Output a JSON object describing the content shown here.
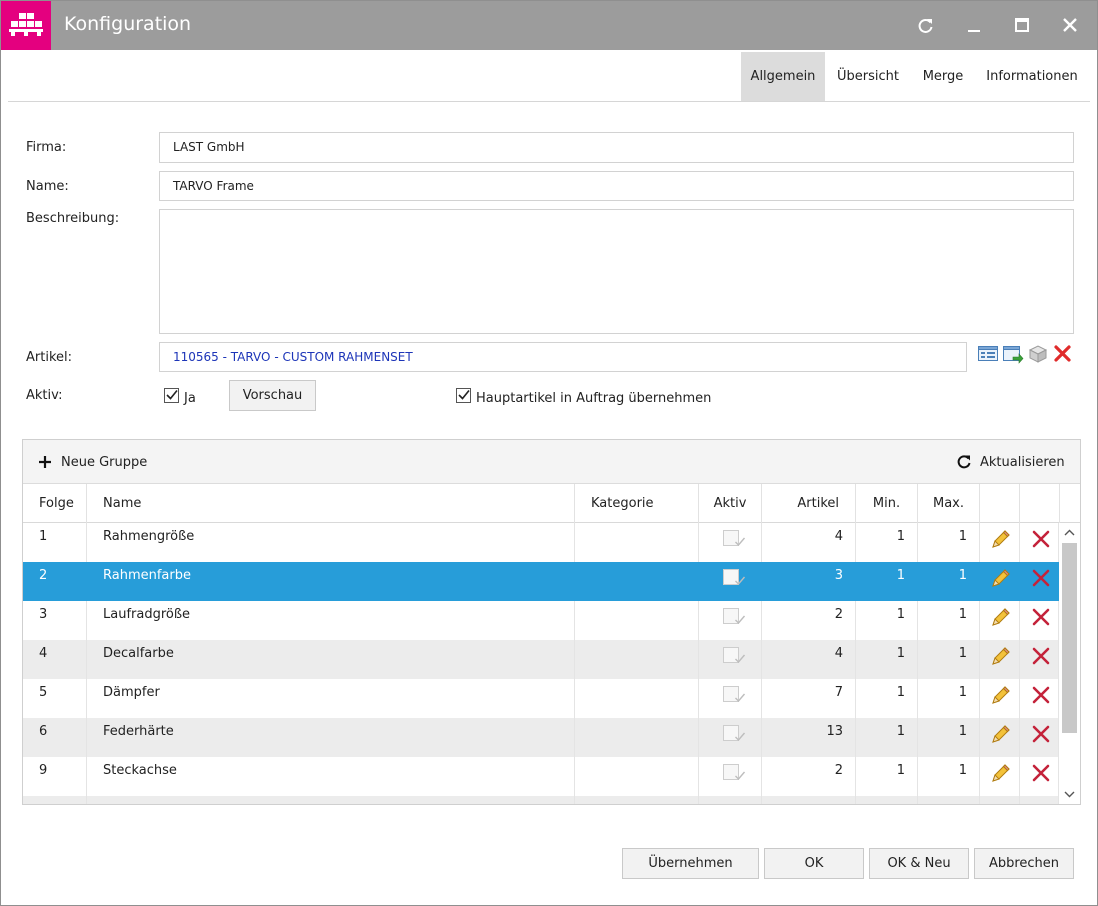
{
  "window": {
    "title": "Konfiguration",
    "colors": {
      "titlebar": "#9c9c9c",
      "logo": "#e4007f",
      "selection": "#279dd9",
      "link": "#1d35b8"
    }
  },
  "tabs": [
    {
      "label": "Allgemein",
      "active": true
    },
    {
      "label": "Übersicht"
    },
    {
      "label": "Merge"
    },
    {
      "label": "Informationen"
    }
  ],
  "form": {
    "firma_label": "Firma:",
    "firma_value": "LAST GmbH",
    "name_label": "Name:",
    "name_value": "TARVO Frame",
    "beschreibung_label": "Beschreibung:",
    "beschreibung_value": "",
    "artikel_label": "Artikel:",
    "artikel_value": "110565 - TARVO - CUSTOM RAHMENSET",
    "aktiv_label": "Aktiv:",
    "aktiv_checkbox_label": "Ja",
    "vorschau_label": "Vorschau",
    "hauptartikel_label": "Hauptartikel in Auftrag übernehmen"
  },
  "grid": {
    "toolbar": {
      "new_group": "Neue Gruppe",
      "refresh": "Aktualisieren"
    },
    "columns": {
      "folge": "Folge",
      "name": "Name",
      "kategorie": "Kategorie",
      "aktiv": "Aktiv",
      "artikel": "Artikel",
      "min": "Min.",
      "max": "Max."
    },
    "rows": [
      {
        "folge": "1",
        "name": "Rahmengröße",
        "kategorie": "",
        "aktiv": true,
        "artikel": "4",
        "min": "1",
        "max": "1"
      },
      {
        "folge": "2",
        "name": "Rahmenfarbe",
        "kategorie": "",
        "aktiv": true,
        "artikel": "3",
        "min": "1",
        "max": "1",
        "selected": true
      },
      {
        "folge": "3",
        "name": "Laufradgröße",
        "kategorie": "",
        "aktiv": true,
        "artikel": "2",
        "min": "1",
        "max": "1"
      },
      {
        "folge": "4",
        "name": "Decalfarbe",
        "kategorie": "",
        "aktiv": true,
        "artikel": "4",
        "min": "1",
        "max": "1"
      },
      {
        "folge": "5",
        "name": "Dämpfer",
        "kategorie": "",
        "aktiv": true,
        "artikel": "7",
        "min": "1",
        "max": "1"
      },
      {
        "folge": "6",
        "name": "Federhärte",
        "kategorie": "",
        "aktiv": true,
        "artikel": "13",
        "min": "1",
        "max": "1"
      },
      {
        "folge": "9",
        "name": "Steckachse",
        "kategorie": "",
        "aktiv": true,
        "artikel": "2",
        "min": "1",
        "max": "1"
      }
    ]
  },
  "footer": {
    "uebernehmen": "Übernehmen",
    "ok": "OK",
    "ok_neu": "OK & Neu",
    "abbrechen": "Abbrechen"
  }
}
